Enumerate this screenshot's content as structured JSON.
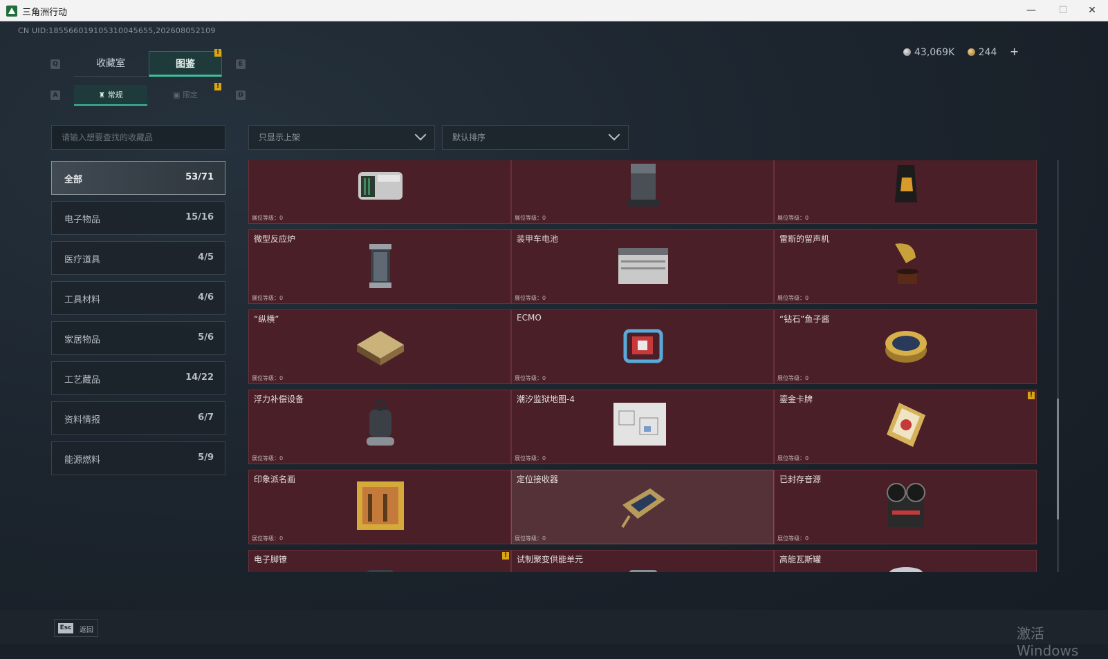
{
  "window": {
    "title": "三角洲行动",
    "minimize": "—",
    "maximize": "☐",
    "close": "✕"
  },
  "uid": "CN UID:185566019105310045655,202608052109",
  "currency": {
    "silver": "43,069K",
    "gold": "244",
    "add": "+"
  },
  "tabs": {
    "collection_label": "收藏室",
    "catalog_label": "图鉴",
    "key_prev": "Q",
    "key_next": "E"
  },
  "subtabs": {
    "regular_label": "常规",
    "limited_label": "限定",
    "key_prev": "A",
    "key_next": "D"
  },
  "badges": {
    "alert": "!"
  },
  "search": {
    "placeholder": "请输入想要查找的收藏品"
  },
  "filters": {
    "shelf": "只显示上架",
    "sort": "默认排序"
  },
  "categories": [
    {
      "name": "全部",
      "count": "53/71"
    },
    {
      "name": "电子物品",
      "count": "15/16"
    },
    {
      "name": "医疗道具",
      "count": "4/5"
    },
    {
      "name": "工具材料",
      "count": "4/6"
    },
    {
      "name": "家居物品",
      "count": "5/6"
    },
    {
      "name": "工艺藏品",
      "count": "14/22"
    },
    {
      "name": "资料情报",
      "count": "6/7"
    },
    {
      "name": "能源燃料",
      "count": "5/9"
    }
  ],
  "level_text": "展位等级：0",
  "items": [
    {
      "title": "",
      "icon": "server-icon"
    },
    {
      "title": "",
      "icon": "robot-vacuum-icon"
    },
    {
      "title": "",
      "icon": "coffee-bag-icon"
    },
    {
      "title": "微型反应炉",
      "icon": "reactor-icon"
    },
    {
      "title": "装甲车电池",
      "icon": "battery-icon"
    },
    {
      "title": "雷斯的留声机",
      "icon": "gramophone-icon"
    },
    {
      "title": "“纵横”",
      "icon": "chessboard-icon"
    },
    {
      "title": "ECMO",
      "icon": "ecmo-icon"
    },
    {
      "title": "“钻石”鱼子酱",
      "icon": "caviar-tin-icon"
    },
    {
      "title": "浮力补偿设备",
      "icon": "diving-gear-icon"
    },
    {
      "title": "潮汐监狱地图-4",
      "icon": "map-icon"
    },
    {
      "title": "鎏金卡牌",
      "icon": "gold-card-icon"
    },
    {
      "title": "印象派名画",
      "icon": "painting-icon"
    },
    {
      "title": "定位接收器",
      "icon": "gps-receiver-icon"
    },
    {
      "title": "已封存音源",
      "icon": "reel-recorder-icon"
    },
    {
      "title": "电子脚镣",
      "icon": "ankle-monitor-icon"
    },
    {
      "title": "试制聚变供能单元",
      "icon": "fusion-unit-icon"
    },
    {
      "title": "高能瓦斯罐",
      "icon": "gas-tank-icon"
    }
  ],
  "bottom": {
    "esc_key": "Esc",
    "back_label": "返回"
  },
  "watermark": "激活 Windows",
  "colors": {
    "accent": "#3fbf9b",
    "card_bg": "#4a1f27",
    "badge": "#d9a514"
  }
}
